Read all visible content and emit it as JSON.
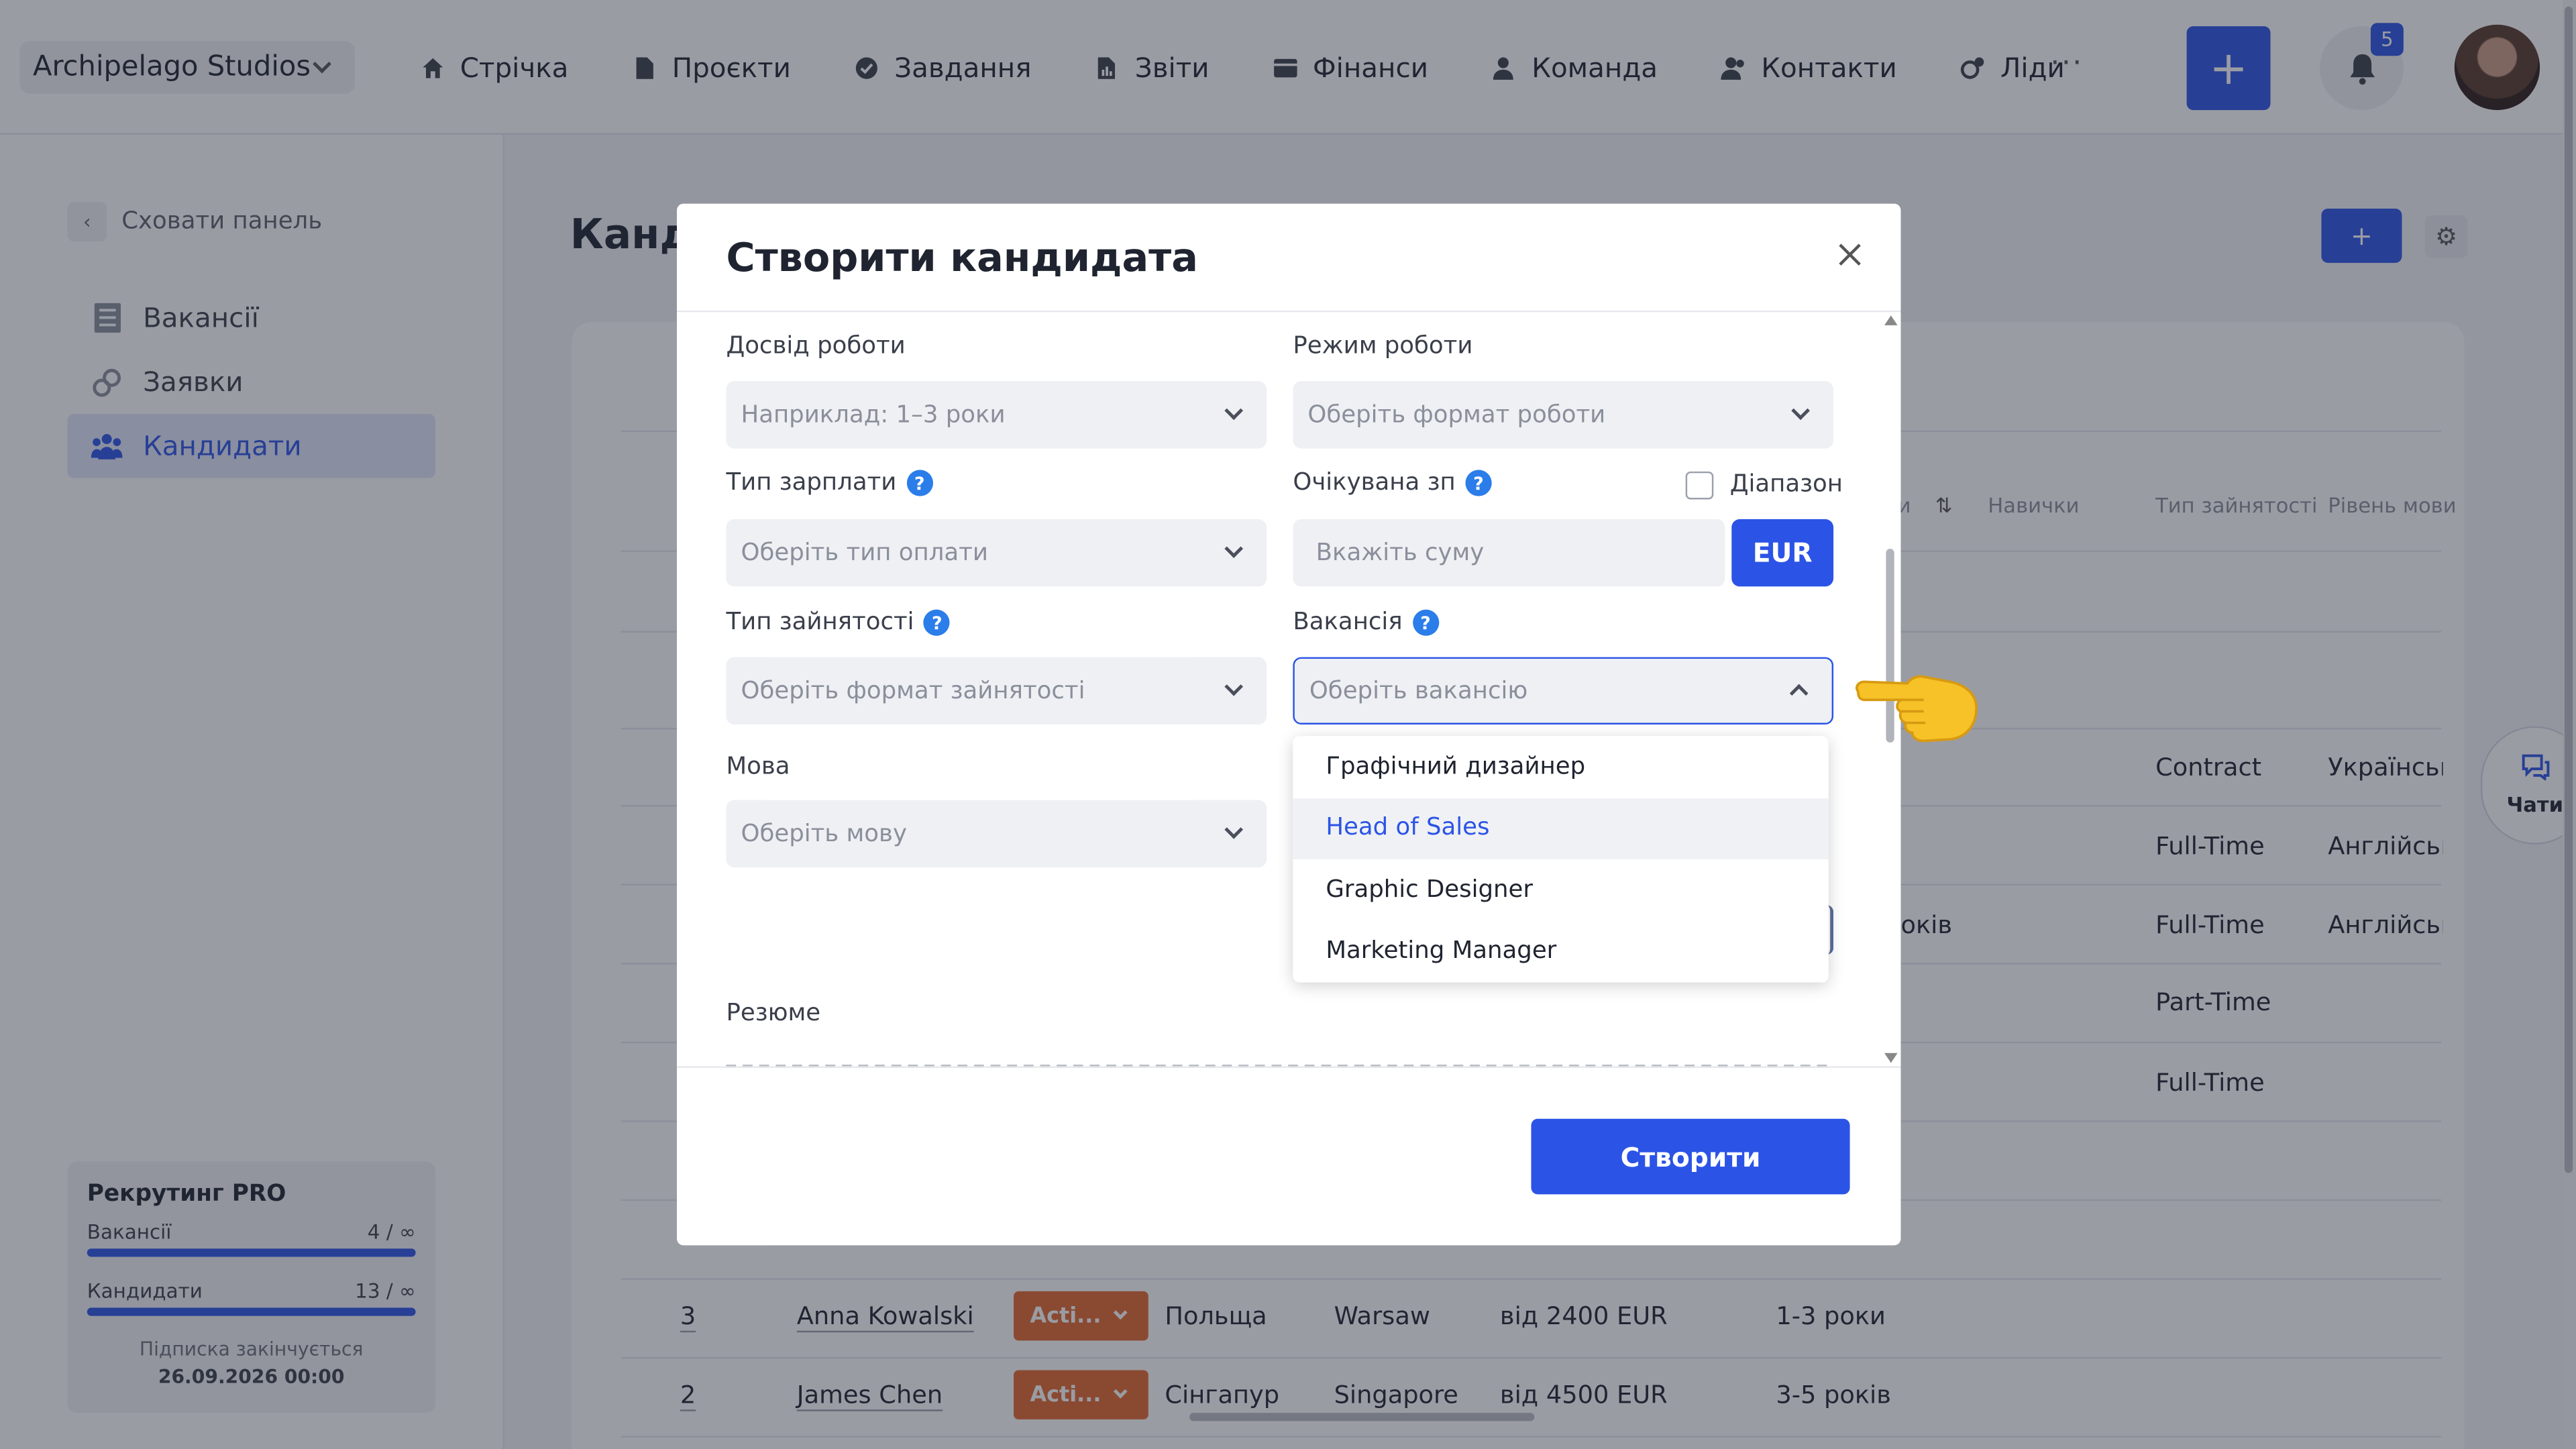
{
  "header": {
    "workspace": "Archipelago Studios",
    "nav": [
      {
        "label": "Стрічка",
        "icon": "home-icon"
      },
      {
        "label": "Проєкти",
        "icon": "file-icon"
      },
      {
        "label": "Завдання",
        "icon": "check-circle-icon"
      },
      {
        "label": "Звіти",
        "icon": "chart-icon"
      },
      {
        "label": "Фінанси",
        "icon": "wallet-icon"
      },
      {
        "label": "Команда",
        "icon": "user-icon"
      },
      {
        "label": "Контакти",
        "icon": "contacts-icon"
      },
      {
        "label": "Ліди",
        "icon": "leads-icon"
      }
    ],
    "more": "···",
    "add_button": "+",
    "notifications_count": "5"
  },
  "sidebar": {
    "hide_panel": "Сховати панель",
    "items": [
      {
        "label": "Вакансії",
        "icon": "list-icon"
      },
      {
        "label": "Заявки",
        "icon": "link-icon"
      },
      {
        "label": "Кандидати",
        "icon": "people-icon",
        "active": true
      }
    ],
    "plan": {
      "title": "Рекрутинг PRO",
      "vacancies_label": "Вакансії",
      "vacancies_value": "4 / ∞",
      "candidates_label": "Кандидати",
      "candidates_value": "13 / ∞",
      "expires_label": "Підписка закінчується",
      "expires_date": "26.09.2026 00:00"
    }
  },
  "page": {
    "title": "Канд",
    "add_button": "+",
    "columns": {
      "experience_partial": "и",
      "skills": "Навички",
      "employment": "Тип зайнятості",
      "language": "Рівень мови"
    },
    "right_cells": [
      {
        "employment": "Contract",
        "language": "Українська"
      },
      {
        "employment": "Full-Time",
        "language": "Англійська"
      },
      {
        "experience_partial": "оків",
        "employment": "Full-Time",
        "language": "Англійська"
      },
      {
        "employment": "Part-Time",
        "language": ""
      },
      {
        "employment": "Full-Time",
        "language": ""
      }
    ],
    "rows": [
      {
        "num": "3",
        "name": "Anna Kowalski",
        "status": "Acti...",
        "country": "Польща",
        "city": "Warsaw",
        "salary": "від 2400 EUR",
        "experience": "1-3 роки"
      },
      {
        "num": "2",
        "name": "James Chen",
        "status": "Acti...",
        "country": "Сінгапур",
        "city": "Singapore",
        "salary": "від 4500 EUR",
        "experience": "3-5 років"
      }
    ],
    "chat_label": "Чати"
  },
  "modal": {
    "title": "Створити кандидата",
    "fields": {
      "experience": {
        "label": "Досвід роботи",
        "placeholder": "Наприклад: 1–3 роки"
      },
      "work_mode": {
        "label": "Режим роботи",
        "placeholder": "Оберіть формат роботи"
      },
      "salary_type": {
        "label": "Тип зарплати",
        "placeholder": "Оберіть тип оплати"
      },
      "expected_salary": {
        "label": "Очікувана зп",
        "placeholder": "Вкажіть суму",
        "currency": "EUR",
        "range_label": "Діапазон"
      },
      "employment_type": {
        "label": "Тип зайнятості",
        "placeholder": "Оберіть формат зайнятості"
      },
      "vacancy": {
        "label": "Вакансія",
        "placeholder": "Оберіть вакансію"
      },
      "language": {
        "label": "Мова",
        "placeholder": "Оберіть мову"
      },
      "resume": {
        "label": "Резюме"
      }
    },
    "vacancy_options": [
      "Графічний дизайнер",
      "Head of Sales",
      "Graphic Designer",
      "Marketing Manager"
    ],
    "hovered_option": "Head of Sales",
    "create_button": "Створити"
  },
  "colors": {
    "accent": "#2b54e6",
    "status_active": "#e2682f",
    "help": "#2b7de9"
  }
}
